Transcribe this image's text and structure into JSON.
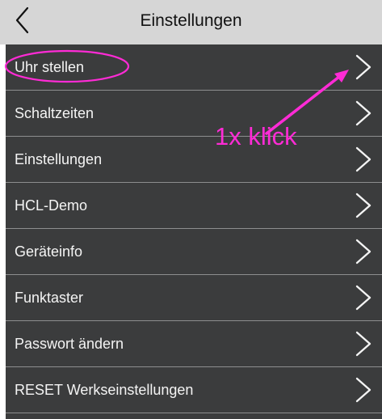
{
  "header": {
    "title": "Einstellungen",
    "back_icon": "chevron-left-icon"
  },
  "menu": {
    "items": [
      {
        "label": "Uhr stellen",
        "icon": "chevron-right-icon"
      },
      {
        "label": "Schaltzeiten",
        "icon": "chevron-right-icon"
      },
      {
        "label": "Einstellungen",
        "icon": "chevron-right-icon"
      },
      {
        "label": "HCL-Demo",
        "icon": "chevron-right-icon"
      },
      {
        "label": "Geräteinfo",
        "icon": "chevron-right-icon"
      },
      {
        "label": "Funktaster",
        "icon": "chevron-right-icon"
      },
      {
        "label": "Passwort ändern",
        "icon": "chevron-right-icon"
      },
      {
        "label": "RESET Werkseinstellungen",
        "icon": "chevron-right-icon"
      }
    ]
  },
  "annotation": {
    "text": "1x klick",
    "color": "#ff2bd6"
  },
  "colors": {
    "header_bg": "#d6d6d6",
    "menu_bg": "#3b3c3d",
    "separator": "#8d8e8f",
    "text_light": "#f4f4f4"
  }
}
